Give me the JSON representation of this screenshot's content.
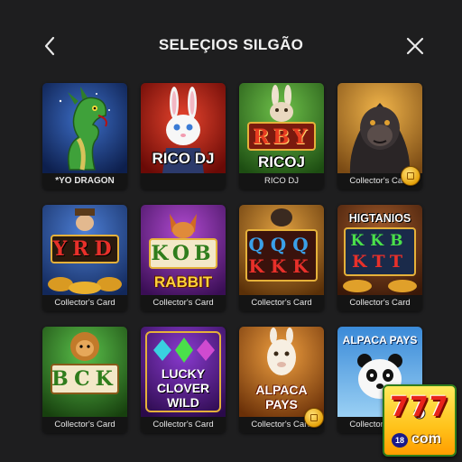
{
  "header": {
    "title": "SELEÇIOS SILGÃO",
    "back_icon": "chevron-left-icon",
    "close_icon": "close-icon"
  },
  "cards": [
    {
      "caption": "*YO DRAGON",
      "art_text": "",
      "badge": false
    },
    {
      "caption": "",
      "art_text": "RICO DJ",
      "badge": false
    },
    {
      "caption": "RICO DJ",
      "art_text": "RICOJ",
      "reels": "RBY",
      "badge": false
    },
    {
      "caption": "Collector's Card",
      "art_text": "",
      "badge": true
    },
    {
      "caption": "Collector's Card",
      "art_text": "",
      "reels": "YRD",
      "badge": false
    },
    {
      "caption": "Collector's Card",
      "art_text": "RABBIT",
      "reels": "KOB",
      "badge": false
    },
    {
      "caption": "Collector's Card",
      "art_text": "",
      "reels_top": "QQQ",
      "reels_bottom": "KKK",
      "badge": false
    },
    {
      "caption": "Collector's Card",
      "art_text": "HIGTANIOS",
      "reels_top": "KKB",
      "reels_bottom": "KTT",
      "badge": false
    },
    {
      "caption": "Collector's Card",
      "art_text": "",
      "reels": "BCK",
      "badge": false
    },
    {
      "caption": "Collector's Card",
      "art_text": "LUCKY CLOVER WILD",
      "art_line1": "LUCKY",
      "art_line2": "CLOVER",
      "art_line3": "WILD",
      "badge": false
    },
    {
      "caption": "Collector's Card",
      "art_text": "ALPACA PAYS",
      "art_line1": "ALPACA",
      "art_line2": "PAYS",
      "badge": true
    },
    {
      "caption": "Collector's Card",
      "art_text": "ALPACA PAYS",
      "badge": false
    }
  ],
  "logo": {
    "main": "777",
    "sub": "18",
    "domain": "com"
  },
  "colors": {
    "background": "#1e1e1f",
    "caption_bg": "#141414",
    "coin": "#e5a20a"
  }
}
